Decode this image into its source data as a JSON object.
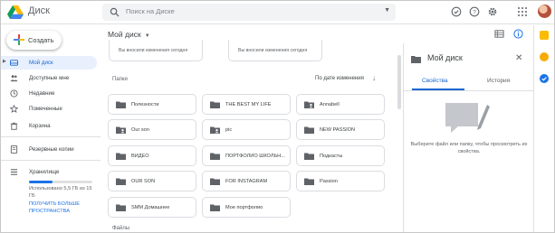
{
  "header": {
    "app_title": "Диск",
    "search_placeholder": "Поиск на Диске",
    "icons": [
      "drive-logo",
      "search-icon",
      "status-check-icon",
      "help-icon",
      "gear-icon",
      "apps-grid-icon",
      "avatar"
    ]
  },
  "sidebar": {
    "create_label": "Создать",
    "items": [
      {
        "label": "Мой диск",
        "active": true,
        "icon": "drive-icon"
      },
      {
        "label": "Доступные мне",
        "active": false,
        "icon": "people-icon"
      },
      {
        "label": "Недавние",
        "active": false,
        "icon": "clock-icon"
      },
      {
        "label": "Помеченные",
        "active": false,
        "icon": "star-icon"
      },
      {
        "label": "Корзина",
        "active": false,
        "icon": "trash-icon"
      },
      {
        "label": "Резервные копии",
        "active": false,
        "icon": "backup-icon"
      }
    ],
    "storage": {
      "label": "Хранилище",
      "usage_text": "Использовано 5,5 ГБ из 15 ГБ",
      "used_fraction": 0.37,
      "buy_link": "ПОЛУЧИТЬ БОЛЬШЕ ПРОСТРАНСТВА"
    }
  },
  "main": {
    "title": "Мой диск",
    "quick_access": [
      {
        "caption": "Вы вносили изменения сегодня"
      },
      {
        "caption": "Вы вносили изменения сегодня"
      }
    ],
    "folders_header": "Папки",
    "sort_label": "По дате изменения",
    "folders": [
      {
        "name": "Полезности",
        "shared": false
      },
      {
        "name": "THE BEST MY LIFE",
        "shared": false
      },
      {
        "name": "Annabell",
        "shared": true
      },
      {
        "name": "Our son",
        "shared": true
      },
      {
        "name": "pic",
        "shared": true
      },
      {
        "name": "NEW PASSION",
        "shared": false
      },
      {
        "name": "ВИДЕО",
        "shared": false
      },
      {
        "name": "ПОРТФОЛИО ШКОЛЬН...",
        "shared": false
      },
      {
        "name": "Подкасты",
        "shared": false
      },
      {
        "name": "OUR SON",
        "shared": false
      },
      {
        "name": "FOR INSTAGRAM",
        "shared": false
      },
      {
        "name": "Passion",
        "shared": false
      },
      {
        "name": "SMM Домашнее",
        "shared": false
      },
      {
        "name": "Мое портфолио",
        "shared": false
      }
    ],
    "files_header": "Файлы"
  },
  "details": {
    "title": "Мой диск",
    "tabs": [
      {
        "label": "Свойства",
        "active": true
      },
      {
        "label": "История",
        "active": false
      }
    ],
    "empty_message": "Выберите файл или папку, чтобы просмотреть их свойства."
  },
  "colors": {
    "accent": "#1a73e8",
    "active_bg": "#e8f0fe",
    "folder_icon": "#5f6368"
  }
}
